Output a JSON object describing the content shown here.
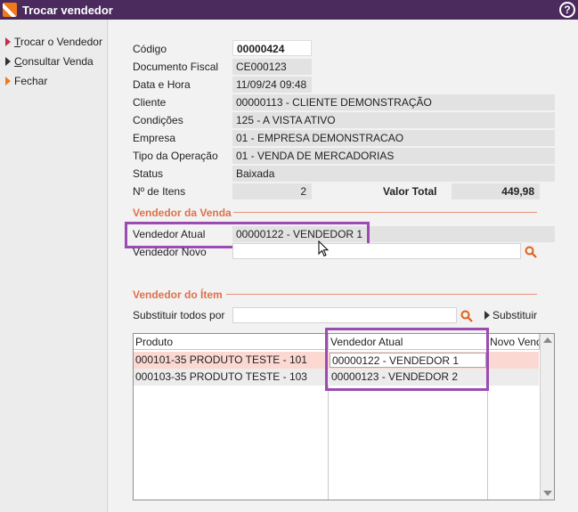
{
  "window": {
    "title": "Trocar vendedor",
    "help_label": "?"
  },
  "sidebar": {
    "items": [
      {
        "label_u": "T",
        "label_rest": "rocar o Vendedor",
        "arrow_color": "#c0304a"
      },
      {
        "label_u": "C",
        "label_rest": "onsultar Venda",
        "arrow_color": "#333333"
      },
      {
        "label_u": "",
        "label_rest": "Fechar",
        "arrow_color": "#f07a1a"
      }
    ]
  },
  "form": {
    "codigo": {
      "label": "Código",
      "value": "00000424"
    },
    "documento_fiscal": {
      "label": "Documento Fiscal",
      "value": "CE000123"
    },
    "data_hora": {
      "label": "Data e Hora",
      "value": "11/09/24 09:48"
    },
    "cliente": {
      "label": "Cliente",
      "value": "00000113 - CLIENTE DEMONSTRAÇÃO"
    },
    "condicoes": {
      "label": "Condições",
      "value": "125 - A VISTA ATIVO"
    },
    "empresa": {
      "label": "Empresa",
      "value": "01 - EMPRESA DEMONSTRACAO"
    },
    "tipo_operacao": {
      "label": "Tipo da Operação",
      "value": "01 - VENDA DE MERCADORIAS"
    },
    "status": {
      "label": "Status",
      "value": "Baixada"
    },
    "n_itens": {
      "label": "Nº de Itens",
      "value": "2"
    },
    "valor_total": {
      "label": "Valor Total",
      "value": "449,98"
    }
  },
  "vendedor_venda": {
    "section_title": "Vendedor da Venda",
    "atual_label": "Vendedor Atual",
    "atual_value": "00000122 - VENDEDOR 1",
    "novo_label": "Vendedor Novo",
    "novo_value": ""
  },
  "vendedor_item": {
    "section_title": "Vendedor do Ítem",
    "substituir_label": "Substituir todos por",
    "substituir_value": "",
    "substituir_button": "Substituir",
    "columns": [
      "Produto",
      "Vendedor Atual",
      "Novo Vend"
    ],
    "rows": [
      {
        "produto": "000101-35 PRODUTO TESTE - 101",
        "vendedor_atual": "00000122 - VENDEDOR 1",
        "novo": ""
      },
      {
        "produto": "000103-35 PRODUTO TESTE - 103",
        "vendedor_atual": "00000123 - VENDEDOR 2",
        "novo": ""
      }
    ]
  },
  "colors": {
    "titlebar": "#4b2a5d",
    "highlight": "#9b4bb2",
    "section": "#e0704a",
    "selected_row": "#fbd9d2"
  }
}
